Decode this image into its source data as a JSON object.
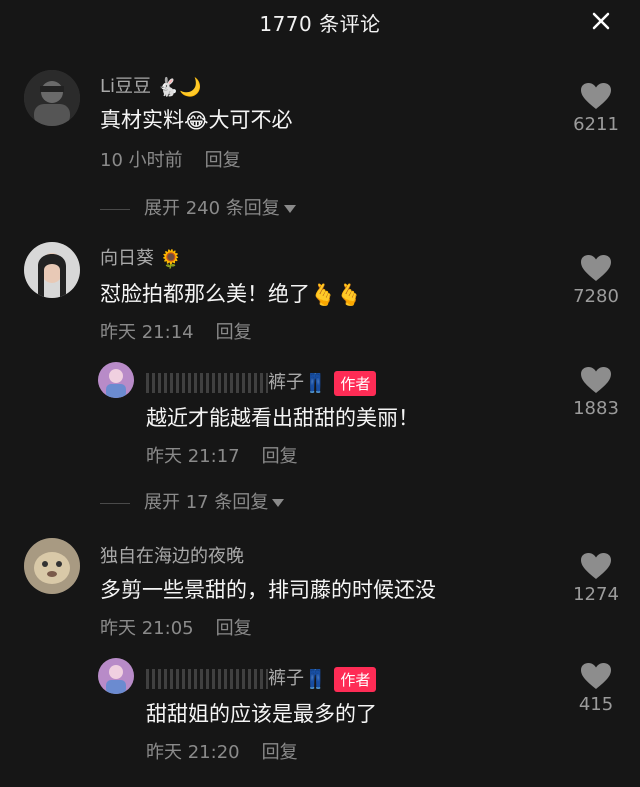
{
  "header": {
    "title": "1770 条评论",
    "close_icon": "close-icon"
  },
  "comments": [
    {
      "username": "Li豆豆",
      "username_emojis": "🐇🌙",
      "text_before": "真材实料",
      "text_emoji": "😂",
      "text_after": "大可不必",
      "time": "10 小时前",
      "reply_label": "回复",
      "likes": "6211",
      "expand_label": "展开 240 条回复"
    },
    {
      "username": "向日葵",
      "username_emoji": "🌻",
      "text": "怼脸拍都那么美！绝了",
      "text_emojis": "🫰🫰",
      "time": "昨天 21:14",
      "reply_label": "回复",
      "likes": "7280"
    },
    {
      "username_suffix": "裤子",
      "username_emoji": "👖",
      "badge": "作者",
      "text": "越近才能越看出甜甜的美丽！",
      "time": "昨天 21:17",
      "reply_label": "回复",
      "likes": "1883",
      "expand_label": "展开 17 条回复"
    },
    {
      "username": "独自在海边的夜晚",
      "text": "多剪一些景甜的，排司藤的时候还没",
      "time": "昨天 21:05",
      "reply_label": "回复",
      "likes": "1274"
    },
    {
      "username_suffix": "裤子",
      "username_emoji": "👖",
      "badge": "作者",
      "text": "甜甜姐的应该是最多的了",
      "time": "昨天 21:20",
      "reply_label": "回复",
      "likes": "415"
    }
  ],
  "colors": {
    "background": "#161616",
    "badge": "#fe2c55",
    "secondary_text": "#8a8a8a"
  }
}
